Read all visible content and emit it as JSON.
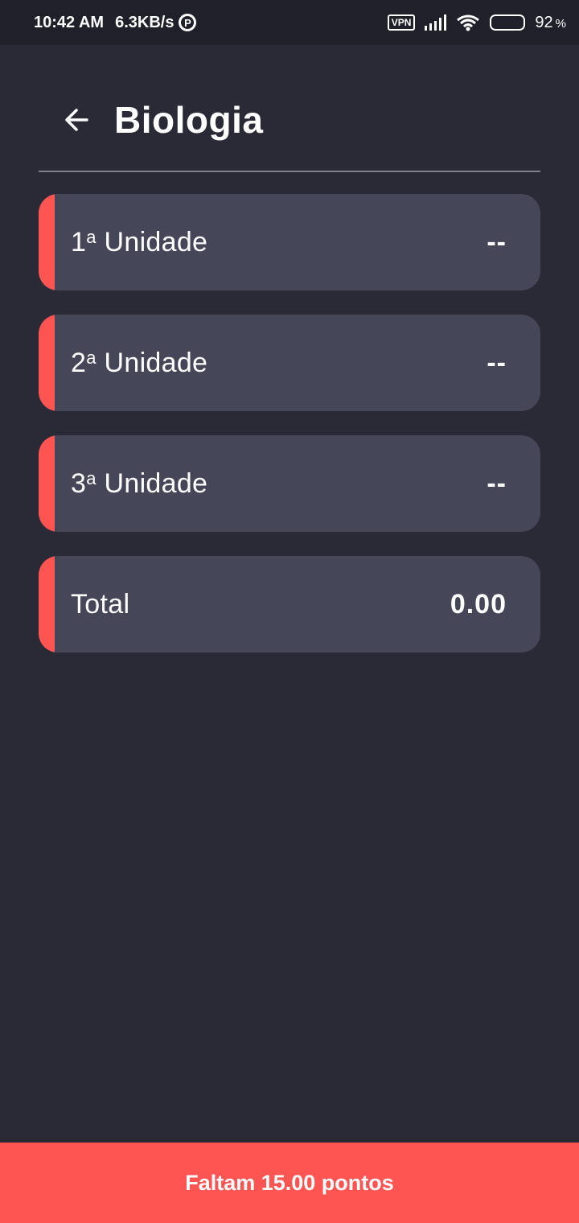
{
  "status_bar": {
    "time": "10:42 AM",
    "speed": "6.3KB/s",
    "vpn": "VPN",
    "battery_level": "92",
    "battery_unit": "%"
  },
  "header": {
    "title": "Biologia",
    "back_icon": "arrow-left-icon"
  },
  "units": [
    {
      "ordinal": "1",
      "suffix": "a",
      "name": " Unidade",
      "value": "--"
    },
    {
      "ordinal": "2",
      "suffix": "a",
      "name": " Unidade",
      "value": "--"
    },
    {
      "ordinal": "3",
      "suffix": "a",
      "name": " Unidade",
      "value": "--"
    }
  ],
  "total": {
    "label": "Total",
    "value": "0.00"
  },
  "footer": {
    "message": "Faltam 15.00 pontos"
  },
  "colors": {
    "background": "#292a36",
    "card": "#454759",
    "accent": "#ff5552",
    "status_bar": "#1f2029"
  }
}
